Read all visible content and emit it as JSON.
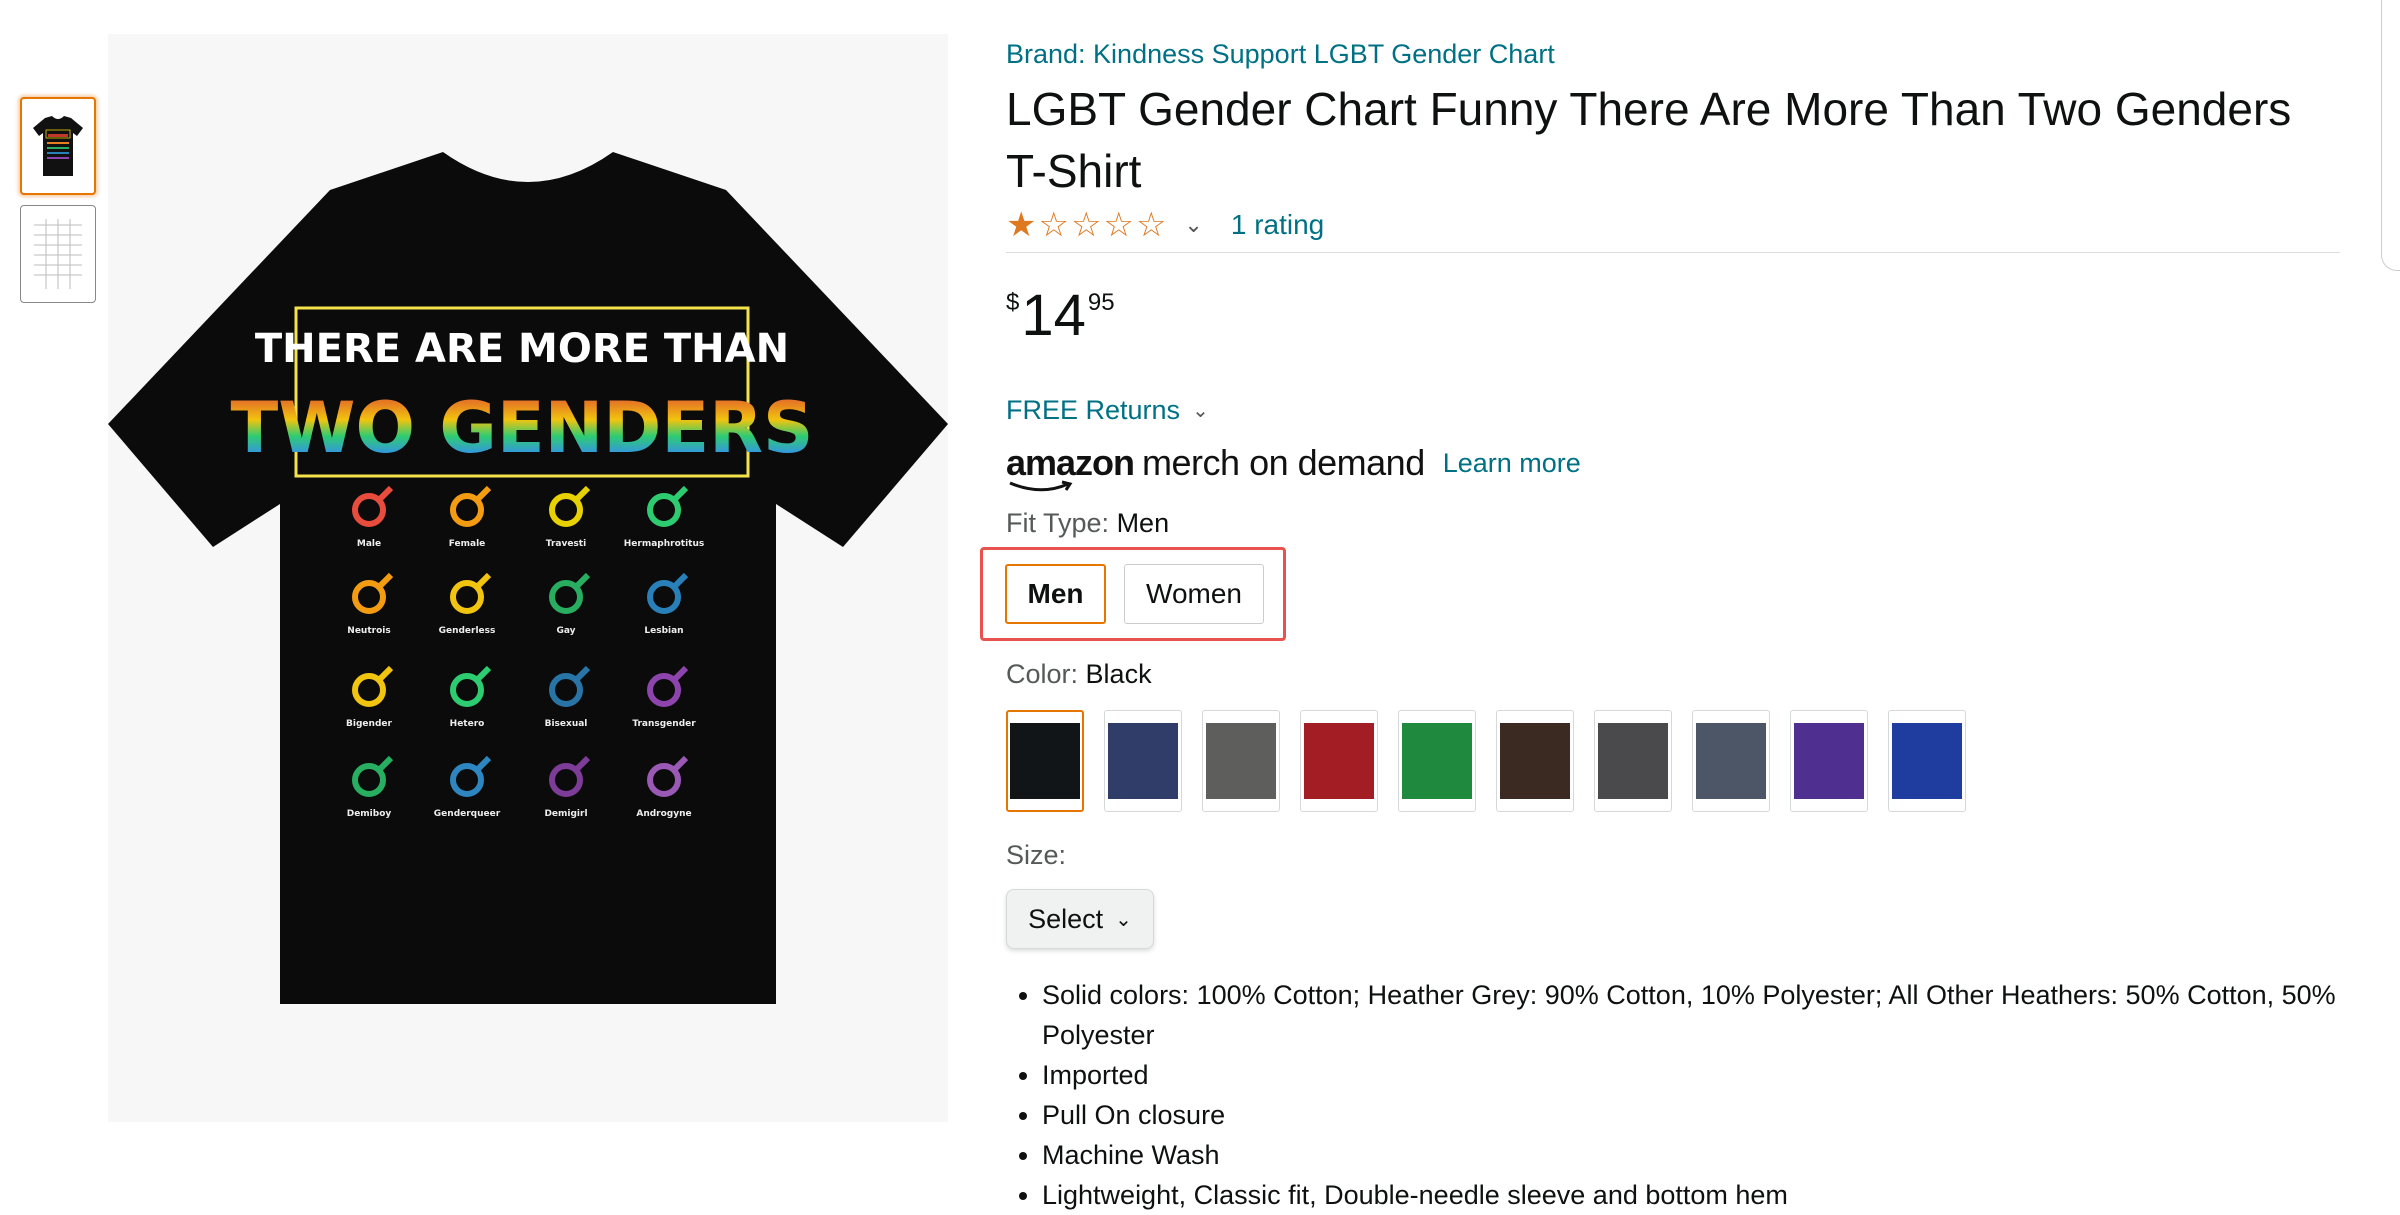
{
  "thumbnails": [
    {
      "name": "shirt-front",
      "selected": true
    },
    {
      "name": "size-chart",
      "selected": false
    }
  ],
  "main_image": {
    "line1": "THERE ARE MORE THAN",
    "line2": "TWO GENDERS",
    "icons": [
      {
        "label": "Male",
        "color": "#e84c3d"
      },
      {
        "label": "Female",
        "color": "#f39c12"
      },
      {
        "label": "Travesti",
        "color": "#e8d100"
      },
      {
        "label": "Hermaphrotitus",
        "color": "#2ecc71"
      },
      {
        "label": "Neutrois",
        "color": "#f39c12"
      },
      {
        "label": "Genderless",
        "color": "#f1c40f"
      },
      {
        "label": "Gay",
        "color": "#27ae60"
      },
      {
        "label": "Lesbian",
        "color": "#2980b9"
      },
      {
        "label": "Bigender",
        "color": "#f1c40f"
      },
      {
        "label": "Hetero",
        "color": "#2ecc71"
      },
      {
        "label": "Bisexual",
        "color": "#2874a6"
      },
      {
        "label": "Transgender",
        "color": "#8e44ad"
      },
      {
        "label": "Demiboy",
        "color": "#27ae60"
      },
      {
        "label": "Genderqueer",
        "color": "#2e86c1"
      },
      {
        "label": "Demigirl",
        "color": "#7d3c98"
      },
      {
        "label": "Androgyne",
        "color": "#9b59b6"
      }
    ]
  },
  "product": {
    "brand": "Brand: Kindness Support LGBT Gender Chart",
    "title": "LGBT Gender Chart Funny There Are More Than Two Genders T-Shirt",
    "rating_link": "1 rating",
    "price_symbol": "$",
    "price_whole": "14",
    "price_fraction": "95",
    "returns": "FREE Returns",
    "merch_amazon": "amazon",
    "merch_text": "merch on demand",
    "learn_more": "Learn more",
    "fit_label": "Fit Type:",
    "fit_value": "Men",
    "fit_options": [
      "Men",
      "Women"
    ],
    "color_label": "Color:",
    "color_value": "Black",
    "colors": [
      "#111518",
      "#2f3d68",
      "#5e5f5c",
      "#a21e24",
      "#1f8a3e",
      "#3a2a22",
      "#4a4a4c",
      "#4c5666",
      "#4f2f8f",
      "#1f3d9e"
    ],
    "size_label": "Size:",
    "size_select": "Select",
    "bullets": [
      "Solid colors: 100% Cotton; Heather Grey: 90% Cotton, 10% Polyester; All Other Heathers: 50% Cotton, 50% Polyester",
      "Imported",
      "Pull On closure",
      "Machine Wash",
      "Lightweight, Classic fit, Double-needle sleeve and bottom hem"
    ]
  }
}
